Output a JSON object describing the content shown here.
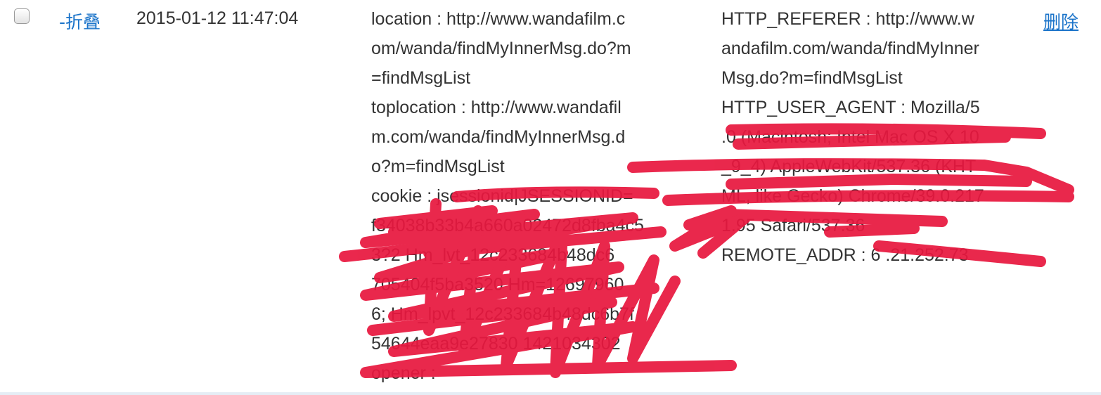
{
  "row": {
    "toggle_label": "-折叠",
    "datetime": "2015-01-12 11:47:04",
    "request_lines": [
      "location : http://www.wandafilm.c",
      "om/wanda/findMyInnerMsg.do?m",
      "=findMsgList",
      "toplocation : http://www.wandafil",
      "m.com/wanda/findMyInnerMsg.d",
      "o?m=findMsgList",
      "cookie : jsessionid|JSESSIONID=",
      "f34038b33b4a660a02472d8fba4c5",
      "3?2 Hm_lvt_12c233684b48dc6",
      "705404f5ba3520 Hm=12697960",
      "6; Hm_lpvt_12c233684b48dc6b7f",
      "54644eaa9e27830 1421034302",
      "opener :"
    ],
    "server_lines": [
      "HTTP_REFERER : http://www.w",
      "andafilm.com/wanda/findMyInner",
      "Msg.do?m=findMsgList",
      "HTTP_USER_AGENT : Mozilla/5",
      ".0 (Macintosh; Intel Mac OS X 10",
      "_9_4) AppleWebKit/537.36 (KHT",
      "ML, like Gecko) Chrome/39.0.217",
      "1.95 Safari/537.36",
      "REMOTE_ADDR : 6 .21.252.73"
    ],
    "delete_label": "删除"
  },
  "colors": {
    "link": "#1a73c9",
    "redaction": "#e8183f",
    "text": "#333333"
  }
}
